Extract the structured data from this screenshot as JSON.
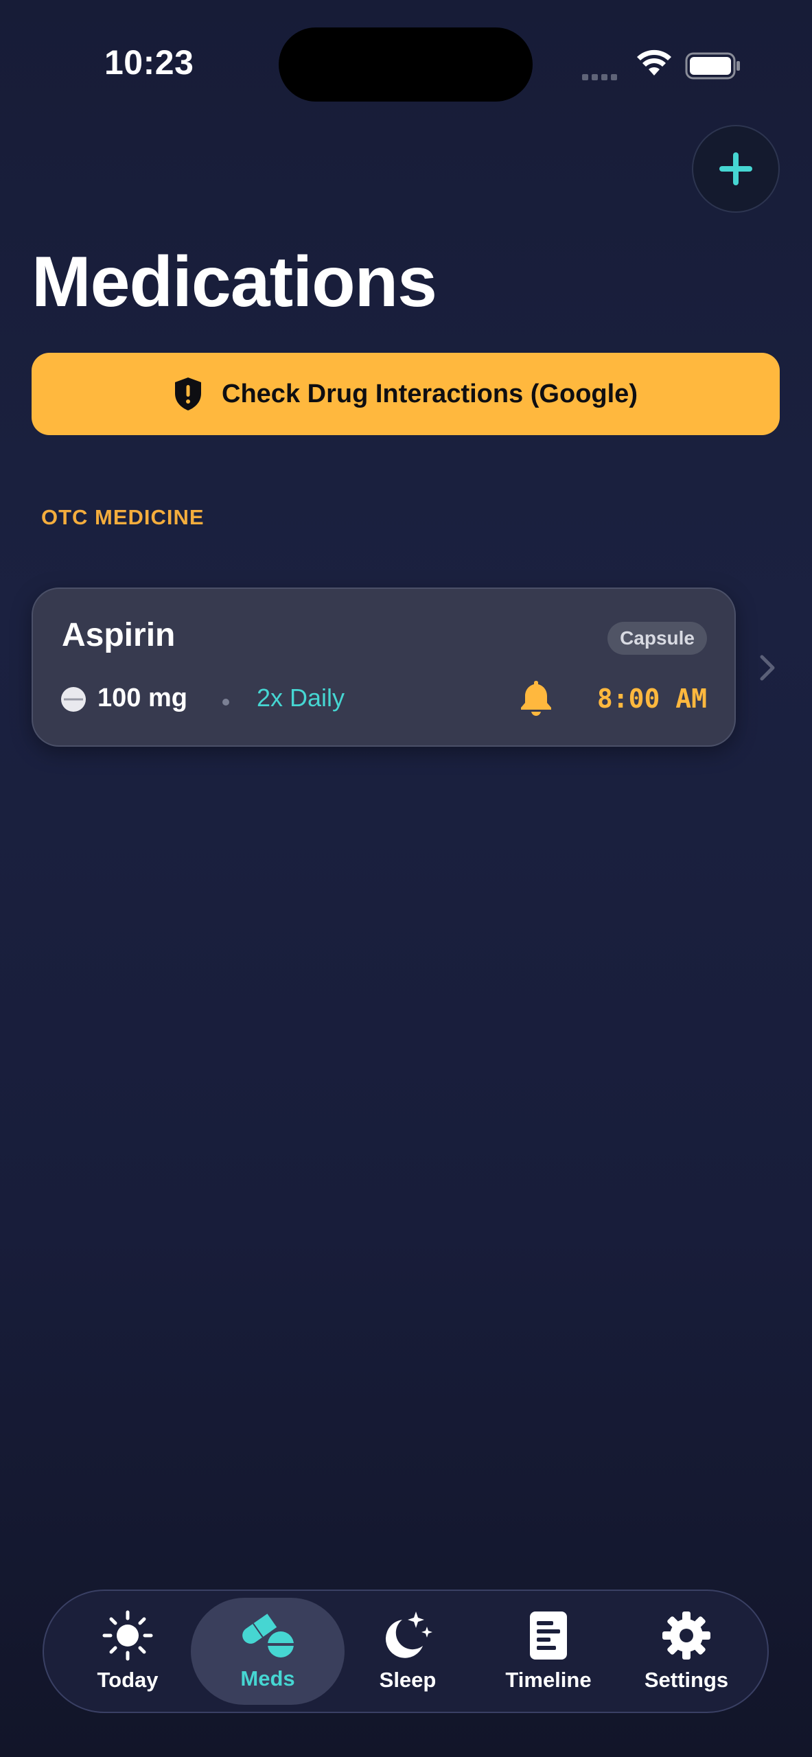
{
  "status_bar": {
    "time": "10:23"
  },
  "page": {
    "title": "Medications"
  },
  "interaction_check": {
    "label": "Check Drug Interactions (Google)"
  },
  "section": {
    "header": "OTC MEDICINE"
  },
  "medications": [
    {
      "name": "Aspirin",
      "form": "Capsule",
      "dose": "100 mg",
      "frequency": "2x Daily",
      "reminder_time": "8:00 AM"
    }
  ],
  "tab_bar": {
    "active": "Meds",
    "items": [
      {
        "label": "Today",
        "icon": "sun-icon"
      },
      {
        "label": "Meds",
        "icon": "pills-icon"
      },
      {
        "label": "Sleep",
        "icon": "moon-stars-icon"
      },
      {
        "label": "Timeline",
        "icon": "document-list-icon"
      },
      {
        "label": "Settings",
        "icon": "gear-icon"
      }
    ]
  },
  "colors": {
    "accent_teal": "#46d6d2",
    "accent_amber": "#ffb83e",
    "background": "#1b2140"
  }
}
